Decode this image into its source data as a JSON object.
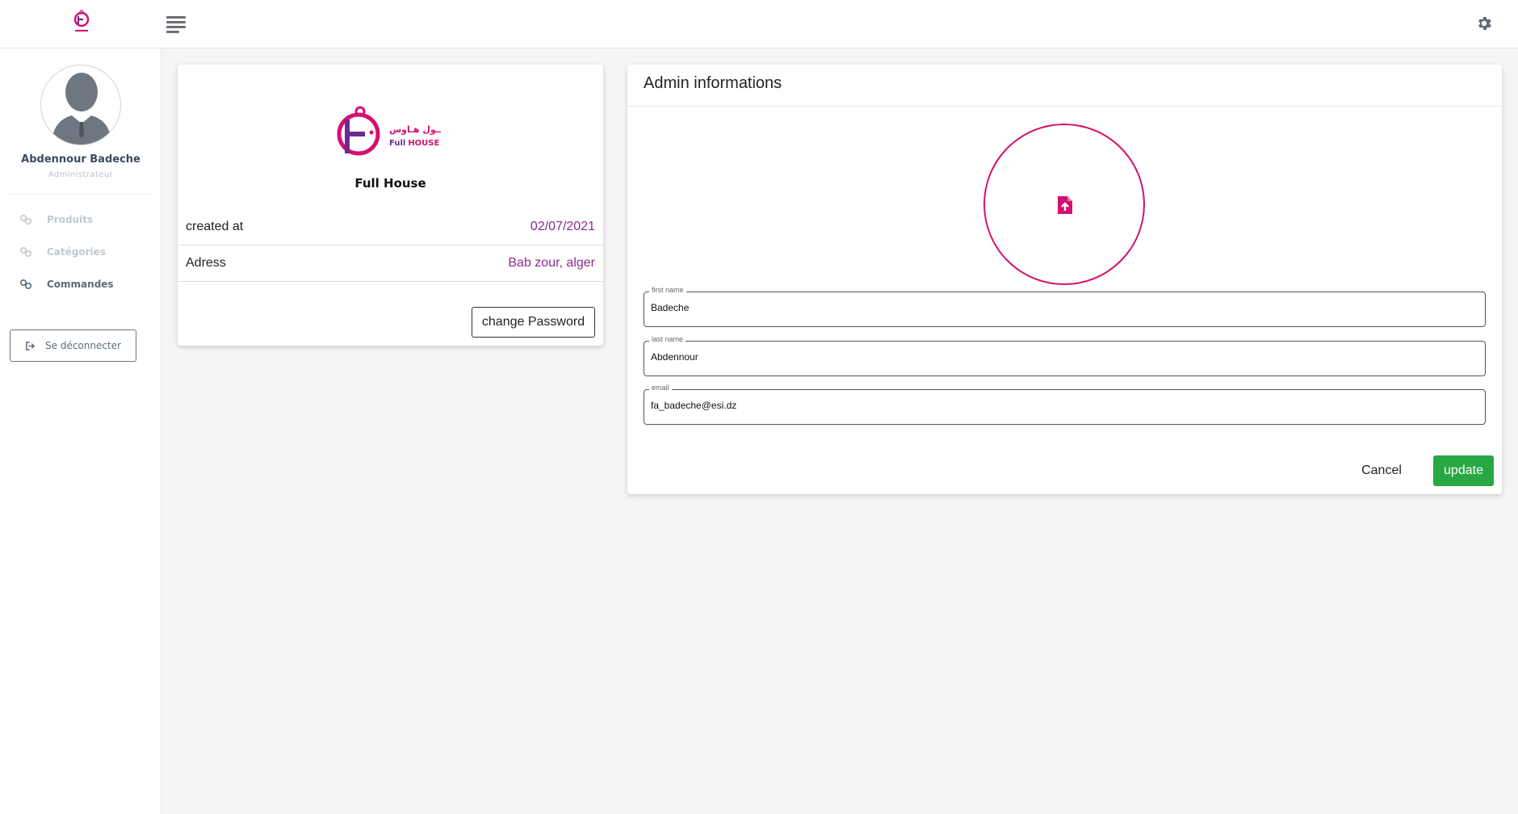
{
  "colors": {
    "brand_magenta": "#d4106f",
    "brand_purple": "#6a2c8f",
    "value_purple": "#8e2a8d",
    "update_green": "#28a745"
  },
  "topbar": {
    "menu_icon": "hamburger-icon",
    "settings_icon": "gear-icon"
  },
  "sidebar": {
    "user_name": "Abdennour Badeche",
    "user_role": "Administrateur",
    "items": [
      {
        "label": "Produits",
        "icon": "link-icon",
        "active": false
      },
      {
        "label": "Catégories",
        "icon": "link-icon",
        "active": false
      },
      {
        "label": "Commandes",
        "icon": "link-icon",
        "active": true
      }
    ],
    "logout_label": "Se déconnecter"
  },
  "company": {
    "logo_arabic": "فــول هـاوس",
    "logo_full": "Full",
    "logo_house": "HOUSE",
    "name": "Full House",
    "created_label": "created at",
    "created_value": "02/07/2021",
    "address_label": "Adress",
    "address_value": "Bab zour, alger",
    "change_password_label": "change Password"
  },
  "admin_form": {
    "title": "Admin informations",
    "upload_icon": "file-upload-icon",
    "fields": [
      {
        "label": "first name",
        "value": "Badeche"
      },
      {
        "label": "last name",
        "value": "Abdennour"
      },
      {
        "label": "email",
        "value": "fa_badeche@esi.dz"
      }
    ],
    "cancel_label": "Cancel",
    "update_label": "update"
  }
}
